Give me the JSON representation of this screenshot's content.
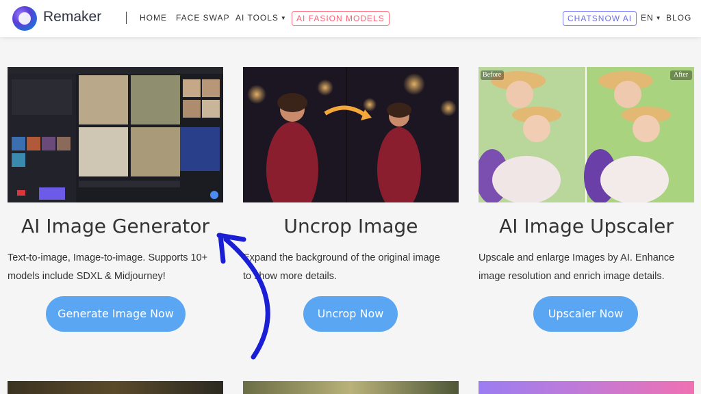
{
  "brand": {
    "name": "Remaker",
    "logo_icon": "remaker-logo-icon"
  },
  "nav": {
    "home": "HOME",
    "face_swap": "FACE SWAP",
    "ai_tools": "AI TOOLS",
    "fasion": "AI FASION MODELS",
    "chatsnow": "CHATSNOW AI",
    "lang": "EN",
    "blog": "BLOG"
  },
  "cards": [
    {
      "title": "AI Image Generator",
      "desc_line1": "Text-to-image, Image-to-image. Supports 10+",
      "desc_line2": "models include SDXL & Midjourney!",
      "button": "Generate Image Now"
    },
    {
      "title": "Uncrop Image",
      "desc_line1": "Expand the background of the original image",
      "desc_line2": "to show more details.",
      "button": "Uncrop Now"
    },
    {
      "title": "AI Image Upscaler",
      "desc_line1": "Upscale and enlarge Images by AI. Enhance",
      "desc_line2": "image resolution and enrich image details.",
      "button": "Upscaler Now"
    }
  ],
  "upscaler_labels": {
    "before": "Before",
    "after": "After"
  },
  "colors": {
    "button": "#5aa6f2",
    "fasion_badge": "#ff5f73",
    "chatsnow_badge": "#6f6fe8",
    "annotation_arrow": "#1a1fd6"
  }
}
